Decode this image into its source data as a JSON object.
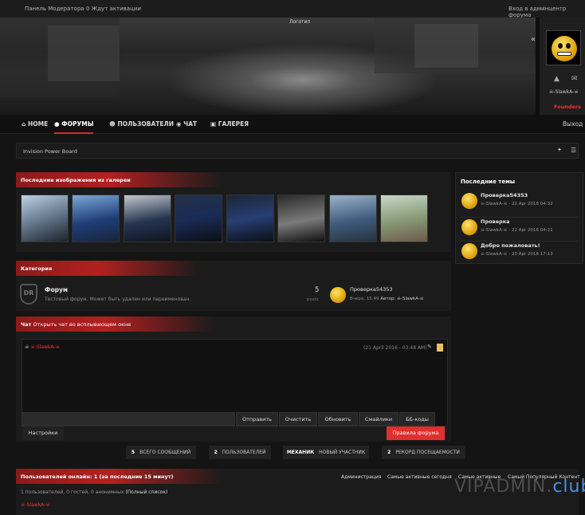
{
  "topbar": {
    "moderator_panel": "Панель Модератора",
    "pending": "0 Ждут активации",
    "admin_login": "Вход в админцентр форума"
  },
  "hero": {
    "logo": "Логотип"
  },
  "user": {
    "name": "☠-SlawkA-☠",
    "group": "Founders"
  },
  "nav": {
    "items": [
      "HOME",
      "ФОРУМЫ",
      "ПОЛЬЗОВАТЕЛИ",
      "ЧАТ",
      "ГАЛЕРЕЯ"
    ],
    "logout": "Выход"
  },
  "breadcrumb": {
    "label": "Invision Power Board"
  },
  "gallery": {
    "title": "Последние изображения из галереи",
    "images": [
      "truck-1",
      "truck-2",
      "truck-3",
      "truck-4",
      "truck-5",
      "car-6",
      "truck-7",
      "girl-8"
    ]
  },
  "category": {
    "title": "Категория",
    "forum_name": "Форум",
    "forum_desc": "Тестовый форум. Может быть удален или переименован.",
    "posts_count": "5",
    "posts_label": "posts",
    "last_topic": "Проверка54353",
    "last_time": "Вчера, 15:49",
    "last_author_label": "Автор:",
    "last_author": "☠-SlawkA-☠"
  },
  "chat": {
    "title": "Чат",
    "open_link": "Открыть чат во всплывающем окне",
    "user": "☠-SlawkA-☠",
    "timestamp": "(21 April 2016 - 03:48 AM)",
    "buttons": [
      "Отправить",
      "Очистить",
      "Обновить",
      "Смайлики",
      "ББ-коды"
    ],
    "settings": "Настройки",
    "rules": "Правила форума"
  },
  "stats": [
    {
      "n": "5",
      "label": "ВСЕГО СООБЩЕНИЙ"
    },
    {
      "n": "2",
      "label": "ПОЛЬЗОВАТЕЛЕЙ"
    },
    {
      "n": "МЕХАНИК",
      "label": "НОВЫЙ УЧАСТНИК"
    },
    {
      "n": "2",
      "label": "РЕКОРД ПОСЕЩАЕМОСТИ"
    }
  ],
  "online": {
    "title": "Пользователей онлайн: 1 (за последние 15 минут)",
    "links": [
      "Администрация",
      "Самые активные сегодня",
      "Самые активные",
      "Самый Популярный Контент"
    ],
    "summary": "1 пользователей, 0 гостей, 0 анонимных",
    "full_list": "(Полный список)",
    "user": "☠-SlawkA-☠"
  },
  "recent": {
    "title": "Последние темы",
    "topics": [
      {
        "title": "Проверка54353",
        "meta": "☠-SlawkA-☠ - 22 Apr 2016 04:32"
      },
      {
        "title": "Проверка",
        "meta": "☠-SlawkA-☠ - 22 Apr 2016 04:21"
      },
      {
        "title": "Добро пожаловать!",
        "meta": "☠-SlawkA-☠ - 20 Apr 2016 17:13"
      }
    ]
  },
  "watermark": {
    "text": "VIPADMIN.",
    "tld": "club"
  },
  "colors": {
    "accent": "#d32a2a",
    "founders": "#ff2b2b",
    "bg": "#141414"
  }
}
